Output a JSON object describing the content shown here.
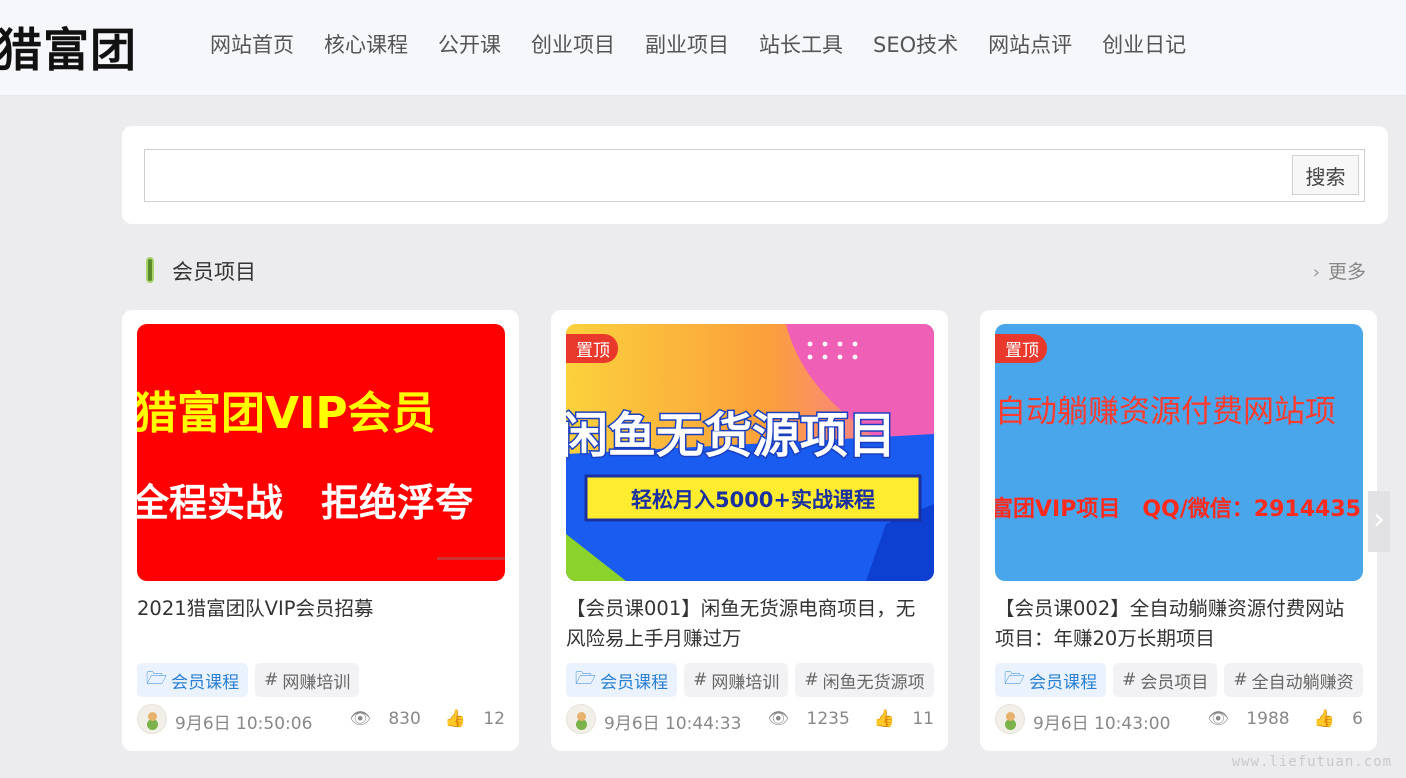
{
  "site": {
    "logo": "猎富团"
  },
  "nav": [
    "网站首页",
    "核心课程",
    "公开课",
    "创业项目",
    "副业项目",
    "站长工具",
    "SEO技术",
    "网站点评",
    "创业日记"
  ],
  "search": {
    "button": "搜索",
    "placeholder": ""
  },
  "section": {
    "title": "会员项目",
    "more": "更多"
  },
  "cards": [
    {
      "pinned": false,
      "pin_label": "",
      "image": {
        "line1": "猎富团VIP会员",
        "line2": "全程实战　拒绝浮夸",
        "bg": "#ff0000",
        "fg": "#ffff00"
      },
      "title": "2021猎富团队VIP会员招募",
      "tags": [
        {
          "label": "会员课程",
          "type": "category"
        },
        {
          "label": "网赚培训",
          "type": "tag"
        }
      ],
      "time": "9月6日 10:50:06",
      "views": "830",
      "likes": "12"
    },
    {
      "pinned": true,
      "pin_label": "置顶",
      "image": {
        "line1": "闲鱼无货源项目",
        "line2": "轻松月入5000+实战课程",
        "bg": "#fbd03b",
        "fg": "#ffffff"
      },
      "title": "【会员课001】闲鱼无货源电商项目，无风险易上手月赚过万",
      "tags": [
        {
          "label": "会员课程",
          "type": "category"
        },
        {
          "label": "网赚培训",
          "type": "tag"
        },
        {
          "label": "闲鱼无货源项",
          "type": "tag"
        }
      ],
      "time": "9月6日 10:44:33",
      "views": "1235",
      "likes": "11"
    },
    {
      "pinned": true,
      "pin_label": "置顶",
      "image": {
        "line1": "自动躺赚资源付费网站项",
        "line2": "富团VIP项目　QQ/微信：2914435",
        "bg": "#4aa6ea",
        "fg": "#ff3a2e"
      },
      "title": "【会员课002】全自动躺赚资源付费网站项目：年赚20万长期项目",
      "tags": [
        {
          "label": "会员课程",
          "type": "category"
        },
        {
          "label": "会员项目",
          "type": "tag"
        },
        {
          "label": "全自动躺赚资",
          "type": "tag"
        }
      ],
      "time": "9月6日 10:43:00",
      "views": "1988",
      "likes": "6"
    }
  ],
  "watermark": "www.liefutuan.com",
  "icons": {
    "search": "none",
    "more": "chevron-right-icon",
    "views": "eye-icon",
    "likes": "thumbs-up-icon",
    "category": "folder-icon",
    "tag": "hash-icon",
    "next": "chevron-right-icon"
  }
}
